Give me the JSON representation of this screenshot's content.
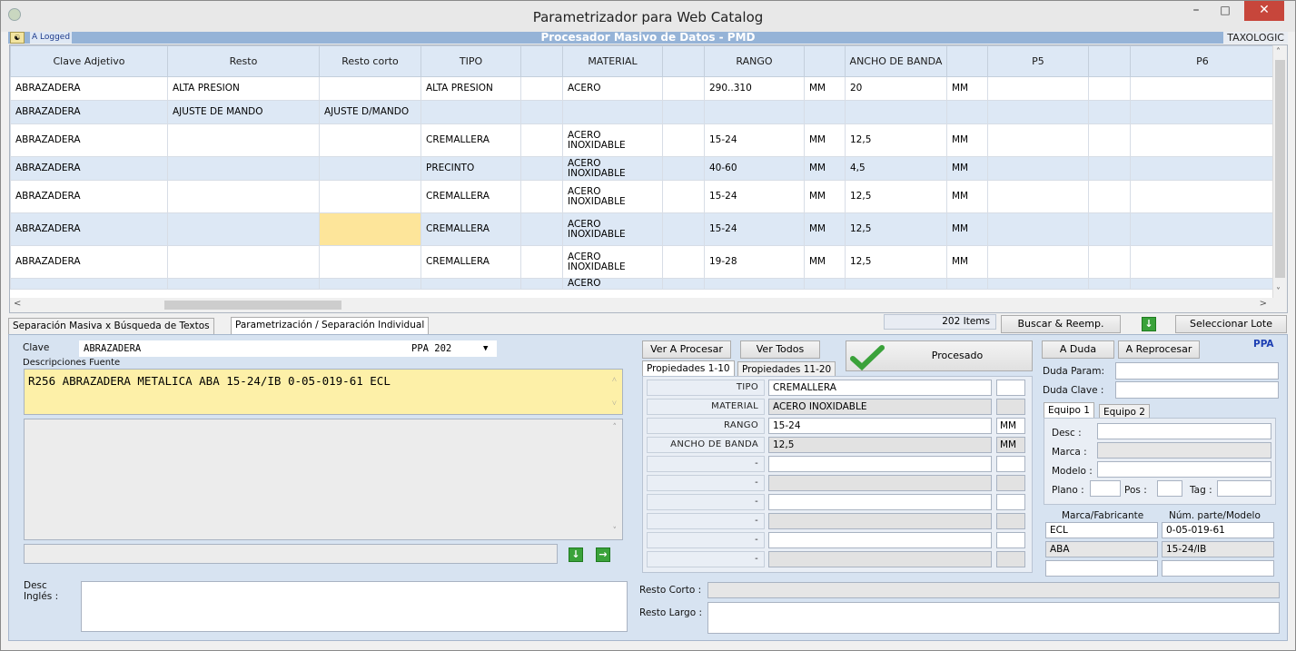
{
  "window": {
    "title": "Parametrizador para Web Catalog"
  },
  "header": {
    "logged": "A Logged",
    "center": "Procesador Masivo de Datos - PMD",
    "right": "TAXOLOGIC"
  },
  "grid": {
    "columns": [
      "Clave Adjetivo",
      "Resto",
      "Resto corto",
      "TIPO",
      "",
      "MATERIAL",
      "",
      "RANGO",
      "",
      "ANCHO DE BANDA",
      "",
      "P5",
      "",
      "P6"
    ],
    "rows": [
      [
        "ABRAZADERA",
        "ALTA PRESION",
        "",
        "ALTA PRESION",
        "",
        "ACERO",
        "",
        "290..310",
        "MM",
        "20",
        "MM",
        "",
        "",
        ""
      ],
      [
        "ABRAZADERA",
        "AJUSTE DE MANDO",
        "AJUSTE D/MANDO",
        "",
        "",
        "",
        "",
        "",
        "",
        "",
        "",
        "",
        "",
        ""
      ],
      [
        "ABRAZADERA",
        "",
        "",
        "CREMALLERA",
        "",
        "ACERO INOXIDABLE",
        "",
        "15-24",
        "MM",
        "12,5",
        "MM",
        "",
        "",
        ""
      ],
      [
        "ABRAZADERA",
        "",
        "",
        "PRECINTO",
        "",
        "ACERO INOXIDABLE",
        "",
        "40-60",
        "MM",
        "4,5",
        "MM",
        "",
        "",
        ""
      ],
      [
        "ABRAZADERA",
        "",
        "",
        "CREMALLERA",
        "",
        "ACERO INOXIDABLE",
        "",
        "15-24",
        "MM",
        "12,5",
        "MM",
        "",
        "",
        ""
      ],
      [
        "ABRAZADERA",
        "",
        "",
        "CREMALLERA",
        "",
        "ACERO INOXIDABLE",
        "",
        "15-24",
        "MM",
        "12,5",
        "MM",
        "",
        "",
        ""
      ],
      [
        "ABRAZADERA",
        "",
        "",
        "CREMALLERA",
        "",
        "ACERO INOXIDABLE",
        "",
        "19-28",
        "MM",
        "12,5",
        "MM",
        "",
        "",
        ""
      ],
      [
        "",
        "",
        "",
        "",
        "",
        "ACERO",
        "",
        "",
        "",
        "",
        "",
        "",
        "",
        ""
      ]
    ]
  },
  "tabs": [
    "Separación Masiva x Búsqueda de Textos",
    "Parametrización / Separación Individual"
  ],
  "toolbar": {
    "items": "202 Items",
    "buscar": "Buscar & Reemp.",
    "seleccionar": "Seleccionar Lote"
  },
  "form": {
    "clave_label": "Clave",
    "clave_value": "ABRAZADERA",
    "ppa_value": "PPA 202",
    "desc_fuente_label": "Descripciones Fuente",
    "desc_fuente_value": "R256 ABRAZADERA METALICA  ABA  15-24/IB  0-05-019-61 ECL",
    "desc_ingles_label": "Desc Inglés :",
    "resto_corto_label": "Resto Corto :",
    "resto_largo_label": "Resto Largo :"
  },
  "actions": {
    "ver_a_procesar": "Ver A Procesar",
    "ver_todos": "Ver Todos",
    "procesado": "Procesado",
    "a_duda": "A Duda",
    "a_reprocesar": "A Reprocesar",
    "ppa": "PPA"
  },
  "prop_tabs": [
    "Propiedades 1-10",
    "Propiedades 11-20"
  ],
  "props": [
    {
      "label": "TIPO",
      "value": "CREMALLERA",
      "unit": "",
      "gray": false
    },
    {
      "label": "MATERIAL",
      "value": "ACERO INOXIDABLE",
      "unit": "",
      "gray": true
    },
    {
      "label": "RANGO",
      "value": "15-24",
      "unit": "MM",
      "gray": false
    },
    {
      "label": "ANCHO DE BANDA",
      "value": "12,5",
      "unit": "MM",
      "gray": true
    },
    {
      "label": "-",
      "value": "",
      "unit": "",
      "gray": false
    },
    {
      "label": "-",
      "value": "",
      "unit": "",
      "gray": true
    },
    {
      "label": "-",
      "value": "",
      "unit": "",
      "gray": false
    },
    {
      "label": "-",
      "value": "",
      "unit": "",
      "gray": true
    },
    {
      "label": "-",
      "value": "",
      "unit": "",
      "gray": false
    },
    {
      "label": "-",
      "value": "",
      "unit": "",
      "gray": true
    }
  ],
  "duda": {
    "param_label": "Duda Param:",
    "clave_label": "Duda Clave :"
  },
  "equipo": {
    "tabs": [
      "Equipo 1",
      "Equipo 2"
    ],
    "desc": "Desc :",
    "marca": "Marca :",
    "modelo": "Modelo :",
    "plano": "Plano :",
    "pos": "Pos :",
    "tag": "Tag :"
  },
  "mfr": {
    "col1": "Marca/Fabricante",
    "col2": "Núm. parte/Modelo",
    "rows": [
      [
        "ECL",
        "0-05-019-61"
      ],
      [
        "ABA",
        "15-24/IB"
      ],
      [
        "",
        ""
      ]
    ]
  },
  "colors": {
    "header": "#95b3d7",
    "panel": "#d7e3f1",
    "highlight": "#fde59a"
  }
}
